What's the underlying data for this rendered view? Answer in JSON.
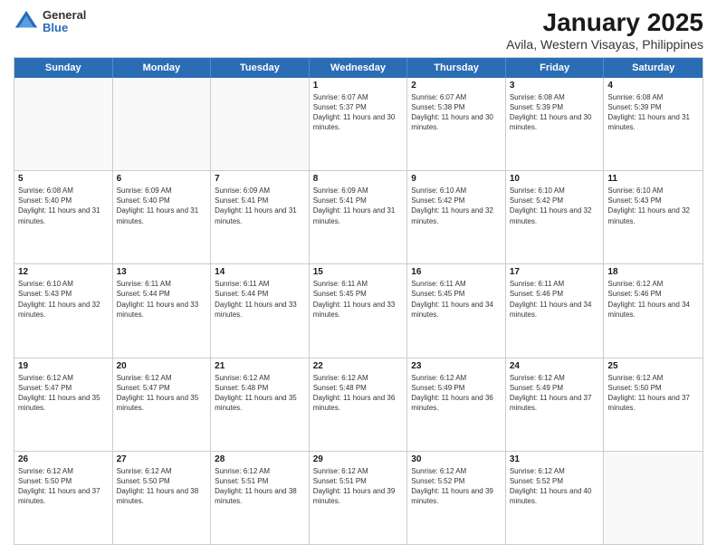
{
  "header": {
    "logo": {
      "line1": "General",
      "line2": "Blue"
    },
    "title": "January 2025",
    "subtitle": "Avila, Western Visayas, Philippines"
  },
  "weekdays": [
    "Sunday",
    "Monday",
    "Tuesday",
    "Wednesday",
    "Thursday",
    "Friday",
    "Saturday"
  ],
  "rows": [
    [
      {
        "day": "",
        "sunrise": "",
        "sunset": "",
        "daylight": ""
      },
      {
        "day": "",
        "sunrise": "",
        "sunset": "",
        "daylight": ""
      },
      {
        "day": "",
        "sunrise": "",
        "sunset": "",
        "daylight": ""
      },
      {
        "day": "1",
        "sunrise": "Sunrise: 6:07 AM",
        "sunset": "Sunset: 5:37 PM",
        "daylight": "Daylight: 11 hours and 30 minutes."
      },
      {
        "day": "2",
        "sunrise": "Sunrise: 6:07 AM",
        "sunset": "Sunset: 5:38 PM",
        "daylight": "Daylight: 11 hours and 30 minutes."
      },
      {
        "day": "3",
        "sunrise": "Sunrise: 6:08 AM",
        "sunset": "Sunset: 5:39 PM",
        "daylight": "Daylight: 11 hours and 30 minutes."
      },
      {
        "day": "4",
        "sunrise": "Sunrise: 6:08 AM",
        "sunset": "Sunset: 5:39 PM",
        "daylight": "Daylight: 11 hours and 31 minutes."
      }
    ],
    [
      {
        "day": "5",
        "sunrise": "Sunrise: 6:08 AM",
        "sunset": "Sunset: 5:40 PM",
        "daylight": "Daylight: 11 hours and 31 minutes."
      },
      {
        "day": "6",
        "sunrise": "Sunrise: 6:09 AM",
        "sunset": "Sunset: 5:40 PM",
        "daylight": "Daylight: 11 hours and 31 minutes."
      },
      {
        "day": "7",
        "sunrise": "Sunrise: 6:09 AM",
        "sunset": "Sunset: 5:41 PM",
        "daylight": "Daylight: 11 hours and 31 minutes."
      },
      {
        "day": "8",
        "sunrise": "Sunrise: 6:09 AM",
        "sunset": "Sunset: 5:41 PM",
        "daylight": "Daylight: 11 hours and 31 minutes."
      },
      {
        "day": "9",
        "sunrise": "Sunrise: 6:10 AM",
        "sunset": "Sunset: 5:42 PM",
        "daylight": "Daylight: 11 hours and 32 minutes."
      },
      {
        "day": "10",
        "sunrise": "Sunrise: 6:10 AM",
        "sunset": "Sunset: 5:42 PM",
        "daylight": "Daylight: 11 hours and 32 minutes."
      },
      {
        "day": "11",
        "sunrise": "Sunrise: 6:10 AM",
        "sunset": "Sunset: 5:43 PM",
        "daylight": "Daylight: 11 hours and 32 minutes."
      }
    ],
    [
      {
        "day": "12",
        "sunrise": "Sunrise: 6:10 AM",
        "sunset": "Sunset: 5:43 PM",
        "daylight": "Daylight: 11 hours and 32 minutes."
      },
      {
        "day": "13",
        "sunrise": "Sunrise: 6:11 AM",
        "sunset": "Sunset: 5:44 PM",
        "daylight": "Daylight: 11 hours and 33 minutes."
      },
      {
        "day": "14",
        "sunrise": "Sunrise: 6:11 AM",
        "sunset": "Sunset: 5:44 PM",
        "daylight": "Daylight: 11 hours and 33 minutes."
      },
      {
        "day": "15",
        "sunrise": "Sunrise: 6:11 AM",
        "sunset": "Sunset: 5:45 PM",
        "daylight": "Daylight: 11 hours and 33 minutes."
      },
      {
        "day": "16",
        "sunrise": "Sunrise: 6:11 AM",
        "sunset": "Sunset: 5:45 PM",
        "daylight": "Daylight: 11 hours and 34 minutes."
      },
      {
        "day": "17",
        "sunrise": "Sunrise: 6:11 AM",
        "sunset": "Sunset: 5:46 PM",
        "daylight": "Daylight: 11 hours and 34 minutes."
      },
      {
        "day": "18",
        "sunrise": "Sunrise: 6:12 AM",
        "sunset": "Sunset: 5:46 PM",
        "daylight": "Daylight: 11 hours and 34 minutes."
      }
    ],
    [
      {
        "day": "19",
        "sunrise": "Sunrise: 6:12 AM",
        "sunset": "Sunset: 5:47 PM",
        "daylight": "Daylight: 11 hours and 35 minutes."
      },
      {
        "day": "20",
        "sunrise": "Sunrise: 6:12 AM",
        "sunset": "Sunset: 5:47 PM",
        "daylight": "Daylight: 11 hours and 35 minutes."
      },
      {
        "day": "21",
        "sunrise": "Sunrise: 6:12 AM",
        "sunset": "Sunset: 5:48 PM",
        "daylight": "Daylight: 11 hours and 35 minutes."
      },
      {
        "day": "22",
        "sunrise": "Sunrise: 6:12 AM",
        "sunset": "Sunset: 5:48 PM",
        "daylight": "Daylight: 11 hours and 36 minutes."
      },
      {
        "day": "23",
        "sunrise": "Sunrise: 6:12 AM",
        "sunset": "Sunset: 5:49 PM",
        "daylight": "Daylight: 11 hours and 36 minutes."
      },
      {
        "day": "24",
        "sunrise": "Sunrise: 6:12 AM",
        "sunset": "Sunset: 5:49 PM",
        "daylight": "Daylight: 11 hours and 37 minutes."
      },
      {
        "day": "25",
        "sunrise": "Sunrise: 6:12 AM",
        "sunset": "Sunset: 5:50 PM",
        "daylight": "Daylight: 11 hours and 37 minutes."
      }
    ],
    [
      {
        "day": "26",
        "sunrise": "Sunrise: 6:12 AM",
        "sunset": "Sunset: 5:50 PM",
        "daylight": "Daylight: 11 hours and 37 minutes."
      },
      {
        "day": "27",
        "sunrise": "Sunrise: 6:12 AM",
        "sunset": "Sunset: 5:50 PM",
        "daylight": "Daylight: 11 hours and 38 minutes."
      },
      {
        "day": "28",
        "sunrise": "Sunrise: 6:12 AM",
        "sunset": "Sunset: 5:51 PM",
        "daylight": "Daylight: 11 hours and 38 minutes."
      },
      {
        "day": "29",
        "sunrise": "Sunrise: 6:12 AM",
        "sunset": "Sunset: 5:51 PM",
        "daylight": "Daylight: 11 hours and 39 minutes."
      },
      {
        "day": "30",
        "sunrise": "Sunrise: 6:12 AM",
        "sunset": "Sunset: 5:52 PM",
        "daylight": "Daylight: 11 hours and 39 minutes."
      },
      {
        "day": "31",
        "sunrise": "Sunrise: 6:12 AM",
        "sunset": "Sunset: 5:52 PM",
        "daylight": "Daylight: 11 hours and 40 minutes."
      },
      {
        "day": "",
        "sunrise": "",
        "sunset": "",
        "daylight": ""
      }
    ]
  ]
}
